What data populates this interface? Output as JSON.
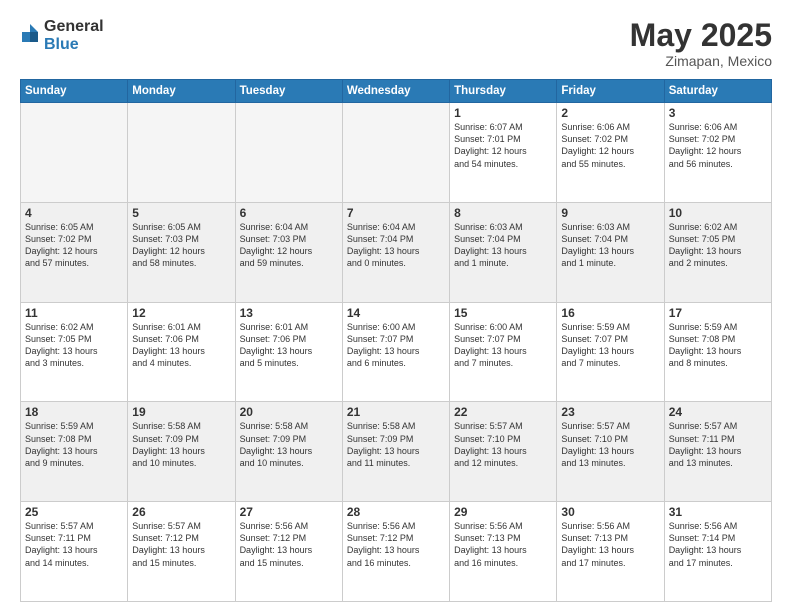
{
  "logo": {
    "general": "General",
    "blue": "Blue"
  },
  "header": {
    "month": "May 2025",
    "location": "Zimapan, Mexico"
  },
  "days_of_week": [
    "Sunday",
    "Monday",
    "Tuesday",
    "Wednesday",
    "Thursday",
    "Friday",
    "Saturday"
  ],
  "weeks": [
    {
      "bg": false,
      "days": [
        {
          "num": "",
          "empty": true,
          "info": ""
        },
        {
          "num": "",
          "empty": true,
          "info": ""
        },
        {
          "num": "",
          "empty": true,
          "info": ""
        },
        {
          "num": "",
          "empty": true,
          "info": ""
        },
        {
          "num": "1",
          "empty": false,
          "info": "Sunrise: 6:07 AM\nSunset: 7:01 PM\nDaylight: 12 hours\nand 54 minutes."
        },
        {
          "num": "2",
          "empty": false,
          "info": "Sunrise: 6:06 AM\nSunset: 7:02 PM\nDaylight: 12 hours\nand 55 minutes."
        },
        {
          "num": "3",
          "empty": false,
          "info": "Sunrise: 6:06 AM\nSunset: 7:02 PM\nDaylight: 12 hours\nand 56 minutes."
        }
      ]
    },
    {
      "bg": true,
      "days": [
        {
          "num": "4",
          "empty": false,
          "info": "Sunrise: 6:05 AM\nSunset: 7:02 PM\nDaylight: 12 hours\nand 57 minutes."
        },
        {
          "num": "5",
          "empty": false,
          "info": "Sunrise: 6:05 AM\nSunset: 7:03 PM\nDaylight: 12 hours\nand 58 minutes."
        },
        {
          "num": "6",
          "empty": false,
          "info": "Sunrise: 6:04 AM\nSunset: 7:03 PM\nDaylight: 12 hours\nand 59 minutes."
        },
        {
          "num": "7",
          "empty": false,
          "info": "Sunrise: 6:04 AM\nSunset: 7:04 PM\nDaylight: 13 hours\nand 0 minutes."
        },
        {
          "num": "8",
          "empty": false,
          "info": "Sunrise: 6:03 AM\nSunset: 7:04 PM\nDaylight: 13 hours\nand 1 minute."
        },
        {
          "num": "9",
          "empty": false,
          "info": "Sunrise: 6:03 AM\nSunset: 7:04 PM\nDaylight: 13 hours\nand 1 minute."
        },
        {
          "num": "10",
          "empty": false,
          "info": "Sunrise: 6:02 AM\nSunset: 7:05 PM\nDaylight: 13 hours\nand 2 minutes."
        }
      ]
    },
    {
      "bg": false,
      "days": [
        {
          "num": "11",
          "empty": false,
          "info": "Sunrise: 6:02 AM\nSunset: 7:05 PM\nDaylight: 13 hours\nand 3 minutes."
        },
        {
          "num": "12",
          "empty": false,
          "info": "Sunrise: 6:01 AM\nSunset: 7:06 PM\nDaylight: 13 hours\nand 4 minutes."
        },
        {
          "num": "13",
          "empty": false,
          "info": "Sunrise: 6:01 AM\nSunset: 7:06 PM\nDaylight: 13 hours\nand 5 minutes."
        },
        {
          "num": "14",
          "empty": false,
          "info": "Sunrise: 6:00 AM\nSunset: 7:07 PM\nDaylight: 13 hours\nand 6 minutes."
        },
        {
          "num": "15",
          "empty": false,
          "info": "Sunrise: 6:00 AM\nSunset: 7:07 PM\nDaylight: 13 hours\nand 7 minutes."
        },
        {
          "num": "16",
          "empty": false,
          "info": "Sunrise: 5:59 AM\nSunset: 7:07 PM\nDaylight: 13 hours\nand 7 minutes."
        },
        {
          "num": "17",
          "empty": false,
          "info": "Sunrise: 5:59 AM\nSunset: 7:08 PM\nDaylight: 13 hours\nand 8 minutes."
        }
      ]
    },
    {
      "bg": true,
      "days": [
        {
          "num": "18",
          "empty": false,
          "info": "Sunrise: 5:59 AM\nSunset: 7:08 PM\nDaylight: 13 hours\nand 9 minutes."
        },
        {
          "num": "19",
          "empty": false,
          "info": "Sunrise: 5:58 AM\nSunset: 7:09 PM\nDaylight: 13 hours\nand 10 minutes."
        },
        {
          "num": "20",
          "empty": false,
          "info": "Sunrise: 5:58 AM\nSunset: 7:09 PM\nDaylight: 13 hours\nand 10 minutes."
        },
        {
          "num": "21",
          "empty": false,
          "info": "Sunrise: 5:58 AM\nSunset: 7:09 PM\nDaylight: 13 hours\nand 11 minutes."
        },
        {
          "num": "22",
          "empty": false,
          "info": "Sunrise: 5:57 AM\nSunset: 7:10 PM\nDaylight: 13 hours\nand 12 minutes."
        },
        {
          "num": "23",
          "empty": false,
          "info": "Sunrise: 5:57 AM\nSunset: 7:10 PM\nDaylight: 13 hours\nand 13 minutes."
        },
        {
          "num": "24",
          "empty": false,
          "info": "Sunrise: 5:57 AM\nSunset: 7:11 PM\nDaylight: 13 hours\nand 13 minutes."
        }
      ]
    },
    {
      "bg": false,
      "days": [
        {
          "num": "25",
          "empty": false,
          "info": "Sunrise: 5:57 AM\nSunset: 7:11 PM\nDaylight: 13 hours\nand 14 minutes."
        },
        {
          "num": "26",
          "empty": false,
          "info": "Sunrise: 5:57 AM\nSunset: 7:12 PM\nDaylight: 13 hours\nand 15 minutes."
        },
        {
          "num": "27",
          "empty": false,
          "info": "Sunrise: 5:56 AM\nSunset: 7:12 PM\nDaylight: 13 hours\nand 15 minutes."
        },
        {
          "num": "28",
          "empty": false,
          "info": "Sunrise: 5:56 AM\nSunset: 7:12 PM\nDaylight: 13 hours\nand 16 minutes."
        },
        {
          "num": "29",
          "empty": false,
          "info": "Sunrise: 5:56 AM\nSunset: 7:13 PM\nDaylight: 13 hours\nand 16 minutes."
        },
        {
          "num": "30",
          "empty": false,
          "info": "Sunrise: 5:56 AM\nSunset: 7:13 PM\nDaylight: 13 hours\nand 17 minutes."
        },
        {
          "num": "31",
          "empty": false,
          "info": "Sunrise: 5:56 AM\nSunset: 7:14 PM\nDaylight: 13 hours\nand 17 minutes."
        }
      ]
    }
  ]
}
